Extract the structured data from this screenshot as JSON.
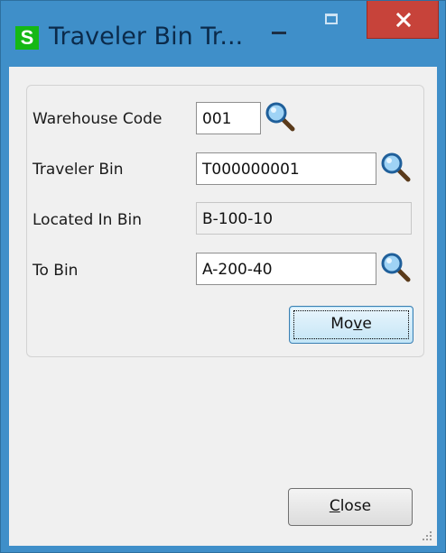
{
  "window": {
    "title": "Traveler Bin Tr...",
    "app_icon_letter": "S"
  },
  "form": {
    "warehouse_code": {
      "label": "Warehouse Code",
      "value": "001"
    },
    "traveler_bin": {
      "label": "Traveler Bin",
      "value": "T000000001"
    },
    "located_in_bin": {
      "label": "Located In Bin",
      "value": "B-100-10"
    },
    "to_bin": {
      "label": "To Bin",
      "value": "A-200-40"
    }
  },
  "buttons": {
    "move": {
      "pre": "Mo",
      "accel": "v",
      "post": "e"
    },
    "close": {
      "pre": "",
      "accel": "C",
      "post": "lose"
    }
  },
  "colors": {
    "title_bar": "#3f8fc9",
    "close_button": "#c7433a",
    "app_icon": "#15b815"
  },
  "icons": [
    "app-icon",
    "minimize-icon",
    "maximize-icon",
    "close-icon",
    "magnifier-icon",
    "resize-grip-icon"
  ]
}
